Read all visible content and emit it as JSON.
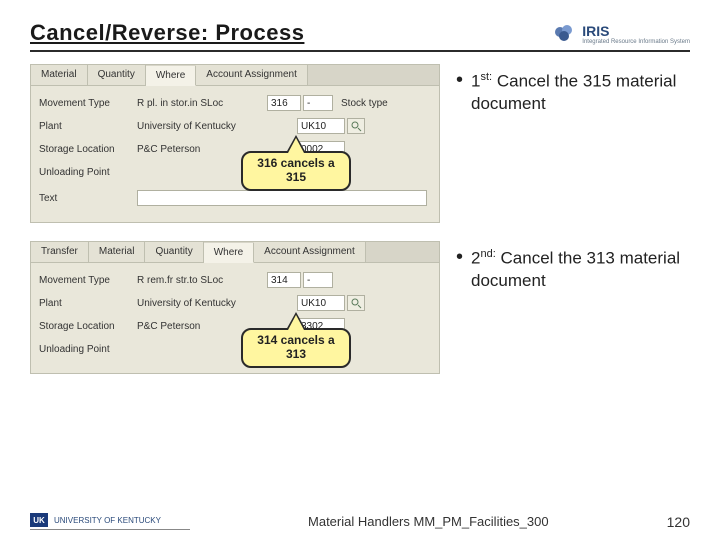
{
  "header": {
    "title": "Cancel/Reverse: Process",
    "logo_text": "IRIS",
    "logo_sub": "Integrated Resource\nInformation System"
  },
  "panel1": {
    "tabs": [
      "Material",
      "Quantity",
      "Where",
      "Account Assignment"
    ],
    "active_tab": 2,
    "movement_type_lbl": "Movement Type",
    "movement_type_val": "R pl. in stor.in SLoc",
    "movement_code": "316",
    "stock_type_lbl": "Stock type",
    "plant_lbl": "Plant",
    "plant_val": "University of Kentucky",
    "plant_code": "UK10",
    "storage_lbl": "Storage Location",
    "storage_val": "P&C Peterson",
    "storage_code": "0002",
    "unloading_lbl": "Unloading Point",
    "text_lbl": "Text",
    "callout": "316 cancels a 315"
  },
  "panel2": {
    "tabs": [
      "Transfer",
      "Material",
      "Quantity",
      "Where",
      "Account Assignment"
    ],
    "active_tab": 3,
    "movement_type_lbl": "Movement Type",
    "movement_type_val": "R rem.fr str.to SLoc",
    "movement_code": "314",
    "plant_lbl": "Plant",
    "plant_val": "University of Kentucky",
    "plant_code": "UK10",
    "storage_lbl": "Storage Location",
    "storage_val": "P&C Peterson",
    "storage_code": "3302",
    "unloading_lbl": "Unloading Point",
    "callout": "314 cancels a 313"
  },
  "bullets": {
    "b1_pre": "1",
    "b1_sup": "st:",
    "b1_txt": " Cancel the 315 material document",
    "b2_pre": "2",
    "b2_sup": "nd:",
    "b2_txt": " Cancel the 313 material document"
  },
  "footer": {
    "uk": "UNIVERSITY OF KENTUCKY",
    "uk_badge": "UK",
    "center": "Material Handlers MM_PM_Facilities_300",
    "page": "120"
  }
}
